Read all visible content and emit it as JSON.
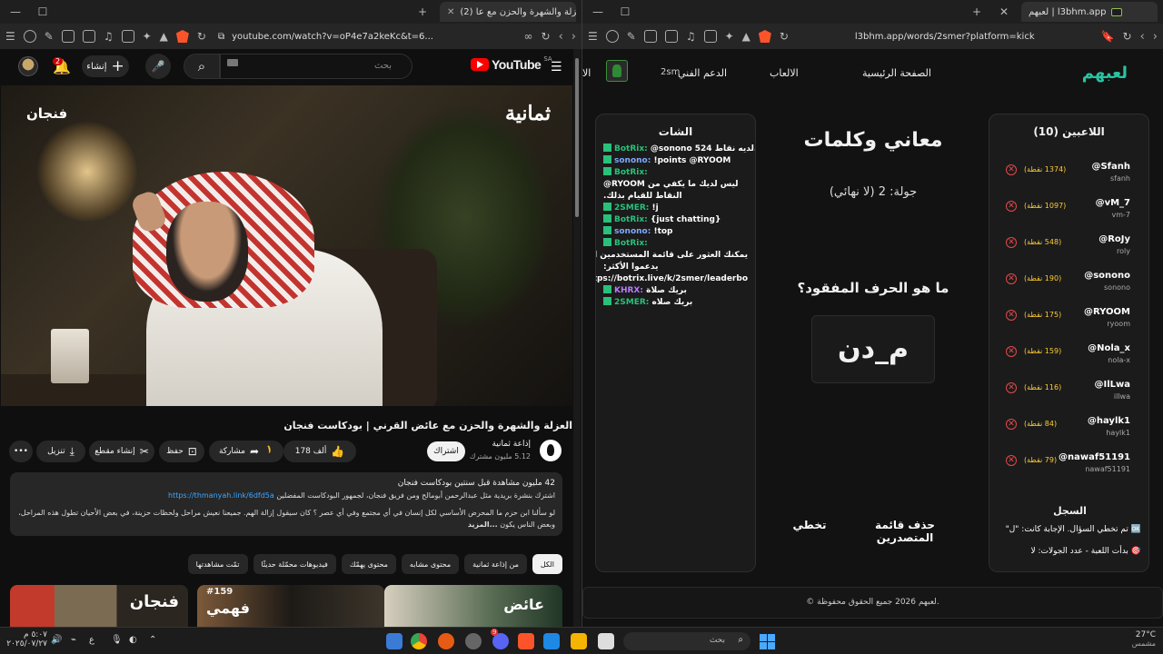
{
  "left_browser": {
    "tab_title": "(2) العزلة والشهرة والحزن مع عا",
    "url": "youtube.com/watch?v=oP4e7a2keKc&t=6..."
  },
  "right_browser": {
    "tab_title": "لعبهم | l3bhm.app",
    "url": "l3bhm.app/words/2smer?platform=kick"
  },
  "youtube": {
    "logo_text": "YouTube",
    "logo_country": "SA",
    "search_placeholder": "بحث",
    "create_label": "إنشاء",
    "notification_count": "2",
    "video_brand_left": "ثمانية",
    "video_brand_right": "فنجان",
    "video_title": "العزلة والشهرة والحزن مع عائض القرني | بودكاست فنجان",
    "channel_name": "إذاعة ثمانية",
    "channel_subs": "5.12 مليون مشترك",
    "subscribe_label": "اشتراك",
    "like_count": "178 ألف",
    "share_label": "مشاركة",
    "save_label": "حفظ",
    "clip_label": "إنشاء مقطع",
    "download_label": "تنزيل",
    "description": {
      "views_line": "42 مليون مشاهدة قبل سنتين بودكاست فنجان",
      "line2_prefix": "اشترك بنشرة بريدية مثل عبدالرحمن أبومالح ومن فريق فنجان، لجمهور البودكاست المفضلين",
      "link": "https://thmanyah.link/6dfd5a",
      "line3": "لو سألنا ابن حزم ما المحرض الأساسي لكل إنسان في أي مجتمع وفي أي عصر ؟ كان سيقول إزالة الهم. جميعنا نعيش مراحل ولحظات حزينة، في بعض الأحيان تطول هذه المراحل، وبعض الناس يكون",
      "more_label": "...المزيد"
    },
    "chips": [
      "الكل",
      "من إذاعة ثمانية",
      "محتوى مشابه",
      "محتوى يهمّك",
      "فيديوهات محمّلة حديثًا",
      "تمّت مشاهدتها"
    ],
    "thumbs": [
      {
        "text": "فنجان"
      },
      {
        "text": "فهمي",
        "episode": "#159"
      },
      {
        "text": "عائض"
      }
    ]
  },
  "l3bhm": {
    "logo": "لعبهم",
    "nav": {
      "home": "الصفحة الرئيسية",
      "games": "الالعاب",
      "support": "الدعم الفني",
      "user": "2sm",
      "extra": "الا"
    },
    "chat": {
      "title": "الشات",
      "messages": [
        {
          "user": "BotRix:",
          "text": "@sonono 524 لديه نقاط.",
          "color": "green"
        },
        {
          "user": "sonono:",
          "text": "!points @RYOOM",
          "color": "blue"
        },
        {
          "user": "BotRix:",
          "text": "",
          "color": "green"
        },
        {
          "user": "",
          "text": "ليس لديك ما يكفي من RYOOM@",
          "color": "none"
        },
        {
          "user": "",
          "text": "النقاط للقيام بذلك.",
          "color": "none"
        },
        {
          "user": "2SMER:",
          "text": "!j",
          "color": "green"
        },
        {
          "user": "BotRix:",
          "text": "{just chatting}",
          "color": "green"
        },
        {
          "user": "sonono:",
          "text": "!top",
          "color": "blue"
        },
        {
          "user": "BotRix:",
          "text": "",
          "color": "green"
        },
        {
          "user": "",
          "text": "يمكنك العثور على قائمة المستخدمين الذين",
          "color": "none"
        },
        {
          "user": "",
          "text": "يدعموا الأكثر:",
          "color": "none"
        },
        {
          "user": "",
          "text": "https://botrix.live/k/2smer/leaderbo",
          "color": "none"
        },
        {
          "user": "KHRX:",
          "text": "بريك صلاة",
          "color": "purple"
        },
        {
          "user": "2SMER:",
          "text": "بريك صلاه",
          "color": "green"
        }
      ]
    },
    "game": {
      "title": "معاني وكلمات",
      "round": "جولة: 2 (لا نهائي)",
      "question": "ما هو الحرف المفقود؟",
      "word": "م_دن",
      "skip_label": "تخطي",
      "delete_list_label": "حذف قائمة المتصدرين"
    },
    "players": {
      "title": "اللاعبين (10)",
      "list": [
        {
          "name": "@Sfanh",
          "handle": "sfanh",
          "points": "(1374 نقطة)"
        },
        {
          "name": "@vM_7",
          "handle": "vm-7",
          "points": "(1097 نقطة)"
        },
        {
          "name": "@RoJy",
          "handle": "roly",
          "points": "(548 نقطة)"
        },
        {
          "name": "@sonono",
          "handle": "sonono",
          "points": "(190 نقطة)"
        },
        {
          "name": "@RYOOM",
          "handle": "ryoom",
          "points": "(175 نقطة)"
        },
        {
          "name": "@Nola_x",
          "handle": "nola-x",
          "points": "(159 نقطة)"
        },
        {
          "name": "@IlLwa",
          "handle": "illwa",
          "points": "(116 نقطة)"
        },
        {
          "name": "@haylk1",
          "handle": "haylk1",
          "points": "(84 نقطة)"
        },
        {
          "name": "@nawaf51191",
          "handle": "nawaf51191",
          "points": "(79 نقطة)"
        }
      ]
    },
    "log": {
      "title": "السجل",
      "lines": [
        "🆗 تم تخطي السؤال. الإجابة كانت: \"ل\"",
        "🎯 بدأت اللعبة - عدد الجولات: لا"
      ]
    },
    "footer": "© لعبهم 2026 جميع الحقوق محفوظة."
  },
  "taskbar": {
    "search_placeholder": "بحث",
    "temperature": "27°C",
    "weather": "مشمس",
    "time": "٥:٠٧ م",
    "date": "٢٠٢٥/٠٧/٢٧",
    "lang": "ع",
    "discord_badge": "9"
  },
  "colors": {
    "brand_green": "#29c4a2",
    "kick_green": "#29c07a",
    "points_yellow": "#ffcc33",
    "remove_red": "#e24a4a",
    "youtube_red": "#ff0000"
  }
}
